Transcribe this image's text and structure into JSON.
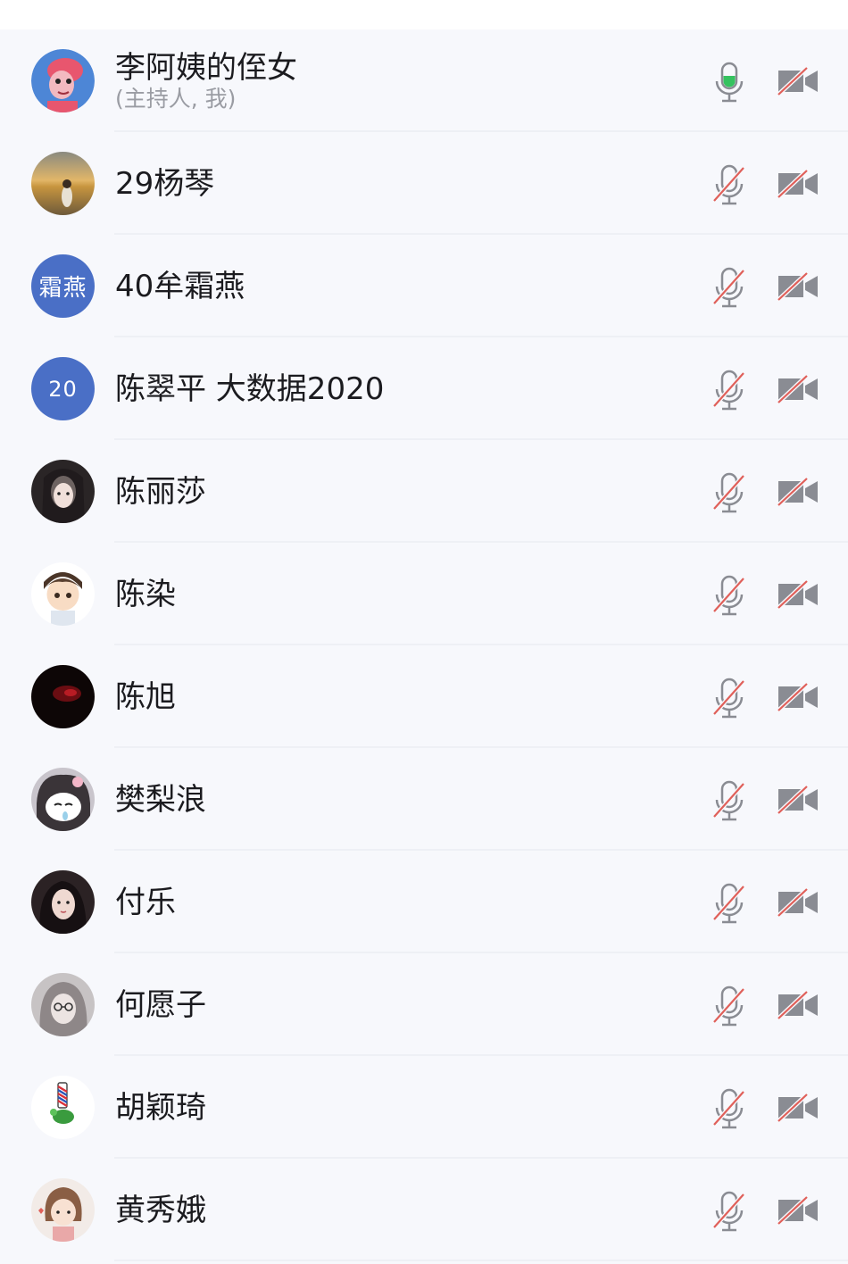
{
  "participants": [
    {
      "name": "李阿姨的侄女",
      "subtitle": "(主持人, 我)",
      "avatar_type": "cartoon-pink-hair",
      "mic_on": true,
      "camera_on": false
    },
    {
      "name": "29杨琴",
      "avatar_type": "sunset-photo",
      "mic_on": false,
      "camera_on": false
    },
    {
      "name": "40牟霜燕",
      "avatar_text": "霜燕",
      "avatar_type": "text",
      "mic_on": false,
      "camera_on": false
    },
    {
      "name": "陈翠平 大数据2020",
      "avatar_text": "20",
      "avatar_type": "text",
      "mic_on": false,
      "camera_on": false
    },
    {
      "name": "陈丽莎",
      "avatar_type": "girl-photo-dark",
      "mic_on": false,
      "camera_on": false
    },
    {
      "name": "陈染",
      "avatar_type": "cartoon-boy",
      "mic_on": false,
      "camera_on": false
    },
    {
      "name": "陈旭",
      "avatar_type": "dark-red-photo",
      "mic_on": false,
      "camera_on": false
    },
    {
      "name": "樊梨浪",
      "avatar_type": "kuromi-cartoon",
      "mic_on": false,
      "camera_on": false
    },
    {
      "name": "付乐",
      "avatar_type": "girl-photo-2",
      "mic_on": false,
      "camera_on": false
    },
    {
      "name": "何愿子",
      "avatar_type": "girl-glasses-drawing",
      "mic_on": false,
      "camera_on": false
    },
    {
      "name": "胡颖琦",
      "avatar_type": "turtle-barber-cartoon",
      "mic_on": false,
      "camera_on": false
    },
    {
      "name": "黄秀娥",
      "avatar_type": "girl-cartoon-heart",
      "mic_on": false,
      "camera_on": false
    }
  ],
  "colors": {
    "mic_active": "#35c25f",
    "icon_gray": "#8a8c93",
    "muted_slash": "#e0605a",
    "text_avatar_bg": "#4a6fc6"
  }
}
